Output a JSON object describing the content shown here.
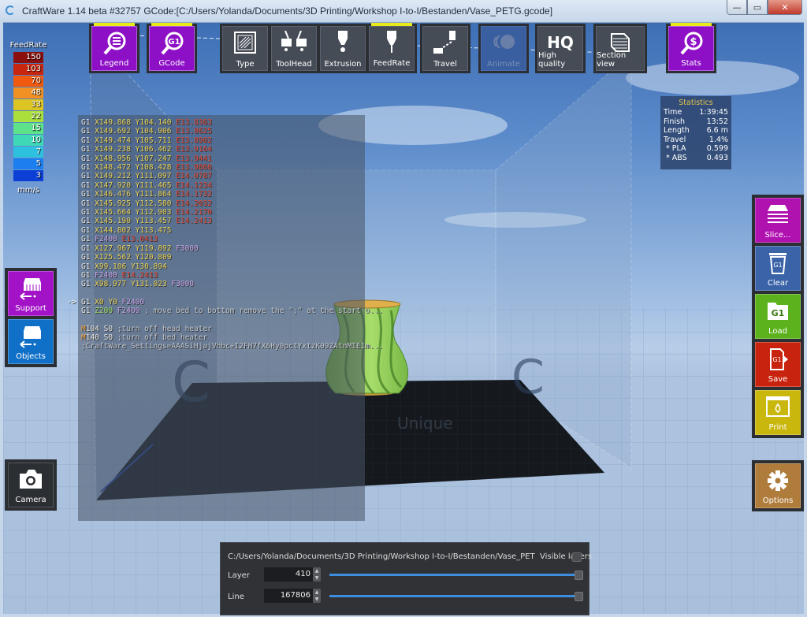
{
  "window": {
    "title": "CraftWare 1.14 beta #32757   GCode:[C:/Users/Yolanda/Documents/3D Printing/Workshop I-to-I/Bestanden/Vase_PETG.gcode]",
    "controls": [
      "minimize",
      "maximize",
      "close"
    ]
  },
  "legend": {
    "title": "FeedRate",
    "unit": "mm/s",
    "entries": [
      {
        "value": "150",
        "color": "#8b0f0c"
      },
      {
        "value": "103",
        "color": "#c8260e"
      },
      {
        "value": "70",
        "color": "#ef5a0f"
      },
      {
        "value": "48",
        "color": "#f19124"
      },
      {
        "value": "33",
        "color": "#dcc522"
      },
      {
        "value": "22",
        "color": "#a9e03b"
      },
      {
        "value": "15",
        "color": "#5de28a"
      },
      {
        "value": "10",
        "color": "#3fd8b6"
      },
      {
        "value": "7",
        "color": "#2ec1df"
      },
      {
        "value": "5",
        "color": "#1b7ff0"
      },
      {
        "value": "3",
        "color": "#0b3fd6"
      }
    ]
  },
  "toolbar": {
    "legend": "Legend",
    "gcode": "GCode",
    "type": "Type",
    "toolhead": "ToolHead",
    "extrusion": "Extrusion",
    "feedrate": "FeedRate",
    "travel": "Travel",
    "animate": "Animate",
    "hq_glyph": "HQ",
    "high_quality": "High quality",
    "section_view": "Section view",
    "stats": "Stats",
    "gcode_glyph": "G1",
    "stats_glyph": "$"
  },
  "gcode_lines": [
    [
      {
        "t": "G1 "
      },
      {
        "k": "X",
        "t": "X149.868 "
      },
      {
        "k": "Y",
        "t": "Y104.140 "
      },
      {
        "k": "E",
        "t": "E13.8363"
      }
    ],
    [
      {
        "t": "G1 "
      },
      {
        "k": "X",
        "t": "X149.692 "
      },
      {
        "k": "Y",
        "t": "Y104.906 "
      },
      {
        "k": "E",
        "t": "E13.8625"
      }
    ],
    [
      {
        "t": "G1 "
      },
      {
        "k": "X",
        "t": "X149.474 "
      },
      {
        "k": "Y",
        "t": "Y105.711 "
      },
      {
        "k": "E",
        "t": "E13.8902"
      }
    ],
    [
      {
        "t": "G1 "
      },
      {
        "k": "X",
        "t": "X149.238 "
      },
      {
        "k": "Y",
        "t": "Y106.462 "
      },
      {
        "k": "E",
        "t": "E13.9164"
      }
    ],
    [
      {
        "t": "G1 "
      },
      {
        "k": "X",
        "t": "X148.956 "
      },
      {
        "k": "Y",
        "t": "Y107.247 "
      },
      {
        "k": "E",
        "t": "E13.9441"
      }
    ],
    [
      {
        "t": "G1 "
      },
      {
        "k": "X",
        "t": "X148.472 "
      },
      {
        "k": "Y",
        "t": "Y108.428 "
      },
      {
        "k": "E",
        "t": "E13.9866"
      }
    ],
    [
      {
        "t": "G1 "
      },
      {
        "k": "X",
        "t": "X149.212 "
      },
      {
        "k": "Y",
        "t": "Y111.097 "
      },
      {
        "k": "E",
        "t": "E14.0787"
      }
    ],
    [
      {
        "t": "G1 "
      },
      {
        "k": "X",
        "t": "X147.920 "
      },
      {
        "k": "Y",
        "t": "Y111.465 "
      },
      {
        "k": "E",
        "t": "E14.1234"
      }
    ],
    [
      {
        "t": "G1 "
      },
      {
        "k": "X",
        "t": "X146.476 "
      },
      {
        "k": "Y",
        "t": "Y111.864 "
      },
      {
        "k": "E",
        "t": "E14.1732"
      }
    ],
    [
      {
        "t": "G1 "
      },
      {
        "k": "X",
        "t": "X145.925 "
      },
      {
        "k": "Y",
        "t": "Y112.580 "
      },
      {
        "k": "E",
        "t": "E14.2032"
      }
    ],
    [
      {
        "t": "G1 "
      },
      {
        "k": "X",
        "t": "X145.664 "
      },
      {
        "k": "Y",
        "t": "Y112.903 "
      },
      {
        "k": "E",
        "t": "E14.2170"
      }
    ],
    [
      {
        "t": "G1 "
      },
      {
        "k": "X",
        "t": "X145.190 "
      },
      {
        "k": "Y",
        "t": "Y113.457 "
      },
      {
        "k": "E",
        "t": "E14.2413"
      }
    ],
    [
      {
        "t": "G1 "
      },
      {
        "k": "X",
        "t": "X144.802 "
      },
      {
        "k": "Y",
        "t": "Y113.475"
      }
    ],
    [
      {
        "t": "G1 "
      },
      {
        "k": "F",
        "t": "F2400 "
      },
      {
        "k": "E",
        "t": "E13.0413"
      }
    ],
    [
      {
        "t": "G1 "
      },
      {
        "k": "X",
        "t": "X127.967 "
      },
      {
        "k": "Y",
        "t": "Y119.892 "
      },
      {
        "k": "F",
        "t": "F3000"
      }
    ],
    [
      {
        "t": "G1 "
      },
      {
        "k": "X",
        "t": "X125.562 "
      },
      {
        "k": "Y",
        "t": "Y120.809"
      }
    ],
    [
      {
        "t": "G1 "
      },
      {
        "k": "X",
        "t": "X99.106 "
      },
      {
        "k": "Y",
        "t": "Y130.894"
      }
    ],
    [
      {
        "t": "G1 "
      },
      {
        "k": "F",
        "t": "F2400 "
      },
      {
        "k": "E",
        "t": "E14.2413"
      }
    ],
    [
      {
        "t": "G1 "
      },
      {
        "k": "X",
        "t": "X98.977 "
      },
      {
        "k": "Y",
        "t": "Y131.023 "
      },
      {
        "k": "F",
        "t": "F3000"
      }
    ],
    [],
    [
      {
        "cur": "->"
      },
      {
        "t": "G1 "
      },
      {
        "k": "X",
        "t": "X0 "
      },
      {
        "k": "Y",
        "t": "Y0 "
      },
      {
        "k": "F",
        "t": "F2400"
      }
    ],
    [
      {
        "t": "G1 "
      },
      {
        "k": "Z",
        "t": "Z200 "
      },
      {
        "k": "F",
        "t": "F2400 "
      },
      {
        "k": "C",
        "t": "; move bed to bottom remove the \";\" at the start o..."
      }
    ],
    [],
    [
      {
        "k": "M",
        "t": "M"
      },
      {
        "t": "104 S0 "
      },
      {
        "k": "C",
        "t": ";turn off head heater"
      }
    ],
    [
      {
        "k": "M",
        "t": "M"
      },
      {
        "t": "140 S0 "
      },
      {
        "k": "C",
        "t": ";turn off bed heater"
      }
    ],
    [
      {
        "k": "C",
        "t": ";CraftWare_Settings=AAASiHjajVhbc+I2FH7fX6Hy0pctYxtzK09ZAtnMIE1m..."
      }
    ]
  ],
  "statistics": {
    "title": "Statistics",
    "rows": [
      {
        "label": "Time",
        "value": "1:39:45"
      },
      {
        "label": "Finish",
        "value": "13:52"
      },
      {
        "label": "Length",
        "value": "6.6 m"
      },
      {
        "label": "Travel",
        "value": "1.4%"
      },
      {
        "label": " * PLA",
        "value": "0.599"
      },
      {
        "label": " * ABS",
        "value": "0.493"
      }
    ]
  },
  "left_buttons": {
    "support": "Support",
    "objects": "Objects",
    "camera": "Camera"
  },
  "right_buttons": {
    "slice": "Slice...",
    "clear": "Clear",
    "load": "Load",
    "save": "Save",
    "print": "Print",
    "options": "Options",
    "g1_glyph": "G1",
    "colors": {
      "slice": "#b012b0",
      "clear": "#3a63a8",
      "load": "#5cb21c",
      "save": "#c8230e",
      "print": "#c9b70e",
      "options": "#b07c3c"
    }
  },
  "bottom_panel": {
    "path": "C:/Users/Yolanda/Documents/3D Printing/Workshop I-to-I/Bestanden/Vase_PET",
    "visible_layers_label": "Visible layers",
    "visible_layers_checked": false,
    "layer_label": "Layer",
    "layer_value": "410",
    "line_label": "Line",
    "line_value": "167806",
    "layer_slider_fraction": 1.0,
    "line_slider_fraction": 1.0
  },
  "scene": {
    "watermark": "Unique",
    "object_color": "#8fd15a"
  }
}
